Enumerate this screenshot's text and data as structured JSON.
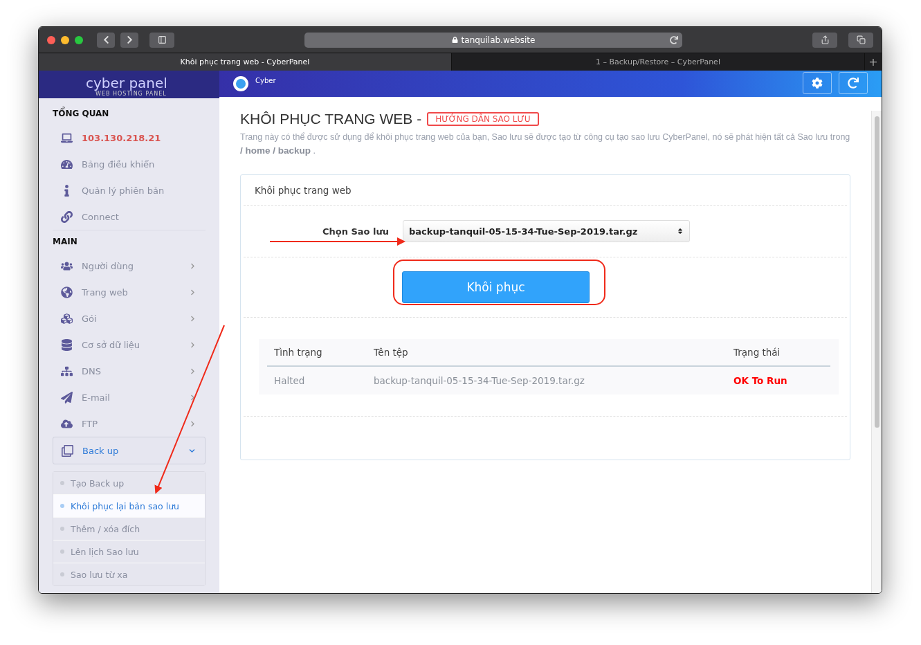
{
  "browser": {
    "url": "tanquilab.website",
    "tabs": [
      {
        "label": "Khôi phục trang web - CyberPanel",
        "selected": true
      },
      {
        "label": "1 – Backup/Restore – CyberPanel",
        "selected": false
      }
    ],
    "new_tab": "+"
  },
  "header": {
    "logo": "cyber panel",
    "logo_tagline": "WEB HOSTING PANEL",
    "user": "Cyber"
  },
  "sidebar": {
    "sections": [
      {
        "title": "TỔNG QUAN",
        "items": [
          {
            "label": "103.130.218.21",
            "kind": "address"
          },
          {
            "label": "Bảng điều khiển",
            "kind": "link"
          },
          {
            "label": "Quản lý phiên bản",
            "kind": "link"
          },
          {
            "label": "Connect",
            "kind": "link"
          }
        ]
      },
      {
        "title": "MAIN",
        "items": [
          {
            "label": "Người dùng",
            "kind": "menu",
            "expanded": false
          },
          {
            "label": "Trang web",
            "kind": "menu",
            "expanded": false
          },
          {
            "label": "Gói",
            "kind": "menu",
            "expanded": false
          },
          {
            "label": "Cơ sở dữ liệu",
            "kind": "menu",
            "expanded": false
          },
          {
            "label": "DNS",
            "kind": "menu",
            "expanded": false
          },
          {
            "label": "E-mail",
            "kind": "menu",
            "expanded": false
          },
          {
            "label": "FTP",
            "kind": "menu",
            "expanded": false
          },
          {
            "label": "Back up",
            "kind": "menu",
            "expanded": true,
            "children": [
              {
                "label": "Tạo Back up",
                "selected": false
              },
              {
                "label": "Khôi phục lại bản sao lưu",
                "selected": true
              },
              {
                "label": "Thêm / xóa đích",
                "selected": false
              },
              {
                "label": "Lên lịch Sao lưu",
                "selected": false
              },
              {
                "label": "Sao lưu từ xa",
                "selected": false
              }
            ]
          }
        ]
      }
    ]
  },
  "page": {
    "title": "KHÔI PHỤC TRANG WEB -",
    "guide_badge": "HƯỚNG DẪN SAO LƯU",
    "description": "Trang này có thể được sử dụng để khôi phục trang web của bạn, Sao lưu sẽ được tạo từ công cụ tạo sao lưu CyberPanel, nó sẽ phát hiện tất cả Sao lưu trong **/ home / backup** ."
  },
  "card": {
    "title": "Khôi phục trang web",
    "select_label": "Chọn Sao lưu",
    "select_value": "backup-tanquil-05-15-34-Tue-Sep-2019.tar.gz",
    "restore_button": "Khôi phục",
    "table": {
      "columns": [
        "Tình trạng",
        "Tên tệp",
        "Trạng thái"
      ],
      "rows": [
        [
          "Halted",
          "backup-tanquil-05-15-34-Tue-Sep-2019.tar.gz",
          "OK To Run"
        ]
      ]
    }
  }
}
